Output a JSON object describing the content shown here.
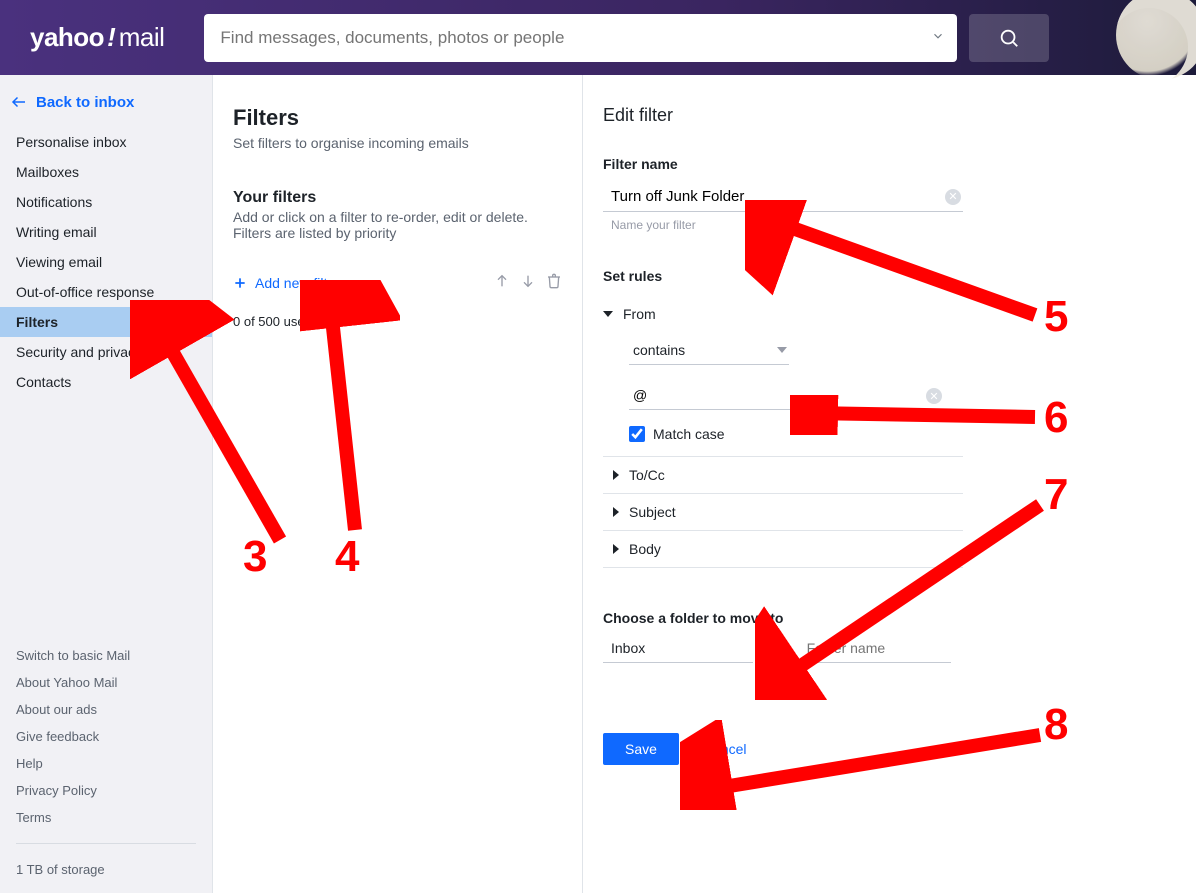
{
  "brand": {
    "yahoo": "yahoo",
    "excl": "!",
    "mail": "mail"
  },
  "search": {
    "placeholder": "Find messages, documents, photos or people"
  },
  "back_to_inbox": "Back to inbox",
  "sidebar": {
    "items": [
      {
        "label": "Personalise inbox"
      },
      {
        "label": "Mailboxes"
      },
      {
        "label": "Notifications"
      },
      {
        "label": "Writing email"
      },
      {
        "label": "Viewing email"
      },
      {
        "label": "Out-of-office response"
      },
      {
        "label": "Filters",
        "active": true
      },
      {
        "label": "Security and privacy"
      },
      {
        "label": "Contacts"
      }
    ],
    "bottom_links": [
      "Switch to basic Mail",
      "About Yahoo Mail",
      "About our ads",
      "Give feedback",
      "Help",
      "Privacy Policy",
      "Terms"
    ],
    "storage": "1 TB of storage"
  },
  "filters_panel": {
    "title": "Filters",
    "subtitle": "Set filters to organise incoming emails",
    "your_filters_title": "Your filters",
    "your_filters_sub": "Add or click on a filter to re-order, edit or delete. Filters are listed by priority",
    "add_new": "Add new filters",
    "used": "0 of 500 used"
  },
  "edit_filter": {
    "title": "Edit filter",
    "filter_name_label": "Filter name",
    "filter_name_value": "Turn off Junk Folder",
    "filter_name_hint": "Name your filter",
    "set_rules_label": "Set rules",
    "rules": {
      "from": {
        "label": "From",
        "condition": "contains",
        "value": "@",
        "match_case_label": "Match case",
        "match_case_checked": true
      },
      "to_cc": {
        "label": "To/Cc"
      },
      "subject": {
        "label": "Subject"
      },
      "body": {
        "label": "Body"
      }
    },
    "choose_folder_label": "Choose a folder to move to",
    "folder_selected": "Inbox",
    "or_label": "or",
    "folder_placeholder": "Folder name",
    "save_label": "Save",
    "cancel_label": "Cancel"
  },
  "annotations": {
    "n3": "3",
    "n4": "4",
    "n5": "5",
    "n6": "6",
    "n7": "7",
    "n8": "8"
  }
}
